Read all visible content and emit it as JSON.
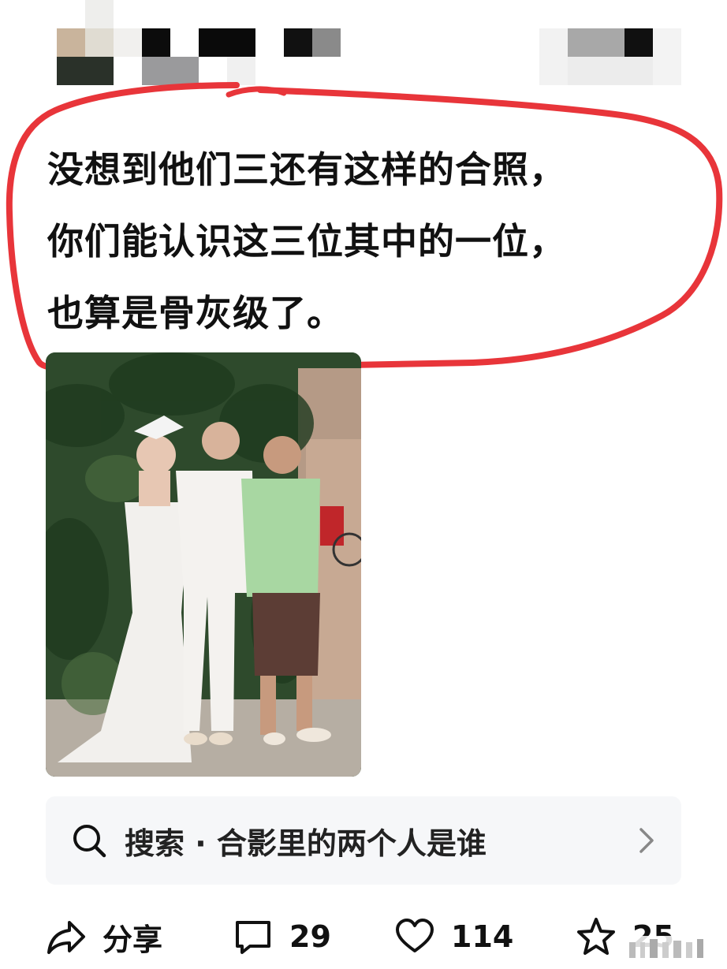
{
  "post": {
    "lines": [
      "没想到他们三还有这样的合照，",
      "你们能认识这三位其中的一位，",
      "也算是骨灰级了。"
    ]
  },
  "search": {
    "label": "搜索 · 合影里的两个人是谁",
    "icon": "search-icon",
    "chevron": "chevron-right-icon"
  },
  "actions": {
    "share": {
      "icon": "share-icon",
      "label": "分享"
    },
    "comment": {
      "icon": "comment-icon",
      "count": "29"
    },
    "like": {
      "icon": "heart-icon",
      "count": "114"
    },
    "favorite": {
      "icon": "star-icon",
      "count": "25"
    }
  },
  "colors": {
    "annotation_red": "#e8353a",
    "search_bg": "#f6f7f9"
  }
}
